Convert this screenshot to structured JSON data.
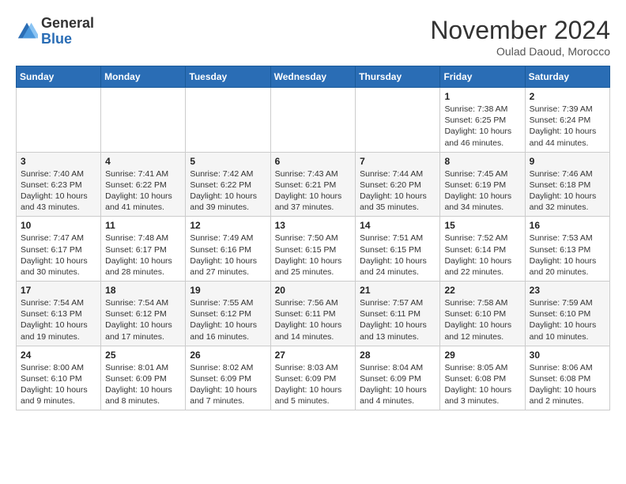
{
  "logo": {
    "general": "General",
    "blue": "Blue"
  },
  "title": "November 2024",
  "subtitle": "Oulad Daoud, Morocco",
  "days_header": [
    "Sunday",
    "Monday",
    "Tuesday",
    "Wednesday",
    "Thursday",
    "Friday",
    "Saturday"
  ],
  "weeks": [
    [
      {
        "day": "",
        "info": ""
      },
      {
        "day": "",
        "info": ""
      },
      {
        "day": "",
        "info": ""
      },
      {
        "day": "",
        "info": ""
      },
      {
        "day": "",
        "info": ""
      },
      {
        "day": "1",
        "info": "Sunrise: 7:38 AM\nSunset: 6:25 PM\nDaylight: 10 hours and 46 minutes."
      },
      {
        "day": "2",
        "info": "Sunrise: 7:39 AM\nSunset: 6:24 PM\nDaylight: 10 hours and 44 minutes."
      }
    ],
    [
      {
        "day": "3",
        "info": "Sunrise: 7:40 AM\nSunset: 6:23 PM\nDaylight: 10 hours and 43 minutes."
      },
      {
        "day": "4",
        "info": "Sunrise: 7:41 AM\nSunset: 6:22 PM\nDaylight: 10 hours and 41 minutes."
      },
      {
        "day": "5",
        "info": "Sunrise: 7:42 AM\nSunset: 6:22 PM\nDaylight: 10 hours and 39 minutes."
      },
      {
        "day": "6",
        "info": "Sunrise: 7:43 AM\nSunset: 6:21 PM\nDaylight: 10 hours and 37 minutes."
      },
      {
        "day": "7",
        "info": "Sunrise: 7:44 AM\nSunset: 6:20 PM\nDaylight: 10 hours and 35 minutes."
      },
      {
        "day": "8",
        "info": "Sunrise: 7:45 AM\nSunset: 6:19 PM\nDaylight: 10 hours and 34 minutes."
      },
      {
        "day": "9",
        "info": "Sunrise: 7:46 AM\nSunset: 6:18 PM\nDaylight: 10 hours and 32 minutes."
      }
    ],
    [
      {
        "day": "10",
        "info": "Sunrise: 7:47 AM\nSunset: 6:17 PM\nDaylight: 10 hours and 30 minutes."
      },
      {
        "day": "11",
        "info": "Sunrise: 7:48 AM\nSunset: 6:17 PM\nDaylight: 10 hours and 28 minutes."
      },
      {
        "day": "12",
        "info": "Sunrise: 7:49 AM\nSunset: 6:16 PM\nDaylight: 10 hours and 27 minutes."
      },
      {
        "day": "13",
        "info": "Sunrise: 7:50 AM\nSunset: 6:15 PM\nDaylight: 10 hours and 25 minutes."
      },
      {
        "day": "14",
        "info": "Sunrise: 7:51 AM\nSunset: 6:15 PM\nDaylight: 10 hours and 24 minutes."
      },
      {
        "day": "15",
        "info": "Sunrise: 7:52 AM\nSunset: 6:14 PM\nDaylight: 10 hours and 22 minutes."
      },
      {
        "day": "16",
        "info": "Sunrise: 7:53 AM\nSunset: 6:13 PM\nDaylight: 10 hours and 20 minutes."
      }
    ],
    [
      {
        "day": "17",
        "info": "Sunrise: 7:54 AM\nSunset: 6:13 PM\nDaylight: 10 hours and 19 minutes."
      },
      {
        "day": "18",
        "info": "Sunrise: 7:54 AM\nSunset: 6:12 PM\nDaylight: 10 hours and 17 minutes."
      },
      {
        "day": "19",
        "info": "Sunrise: 7:55 AM\nSunset: 6:12 PM\nDaylight: 10 hours and 16 minutes."
      },
      {
        "day": "20",
        "info": "Sunrise: 7:56 AM\nSunset: 6:11 PM\nDaylight: 10 hours and 14 minutes."
      },
      {
        "day": "21",
        "info": "Sunrise: 7:57 AM\nSunset: 6:11 PM\nDaylight: 10 hours and 13 minutes."
      },
      {
        "day": "22",
        "info": "Sunrise: 7:58 AM\nSunset: 6:10 PM\nDaylight: 10 hours and 12 minutes."
      },
      {
        "day": "23",
        "info": "Sunrise: 7:59 AM\nSunset: 6:10 PM\nDaylight: 10 hours and 10 minutes."
      }
    ],
    [
      {
        "day": "24",
        "info": "Sunrise: 8:00 AM\nSunset: 6:10 PM\nDaylight: 10 hours and 9 minutes."
      },
      {
        "day": "25",
        "info": "Sunrise: 8:01 AM\nSunset: 6:09 PM\nDaylight: 10 hours and 8 minutes."
      },
      {
        "day": "26",
        "info": "Sunrise: 8:02 AM\nSunset: 6:09 PM\nDaylight: 10 hours and 7 minutes."
      },
      {
        "day": "27",
        "info": "Sunrise: 8:03 AM\nSunset: 6:09 PM\nDaylight: 10 hours and 5 minutes."
      },
      {
        "day": "28",
        "info": "Sunrise: 8:04 AM\nSunset: 6:09 PM\nDaylight: 10 hours and 4 minutes."
      },
      {
        "day": "29",
        "info": "Sunrise: 8:05 AM\nSunset: 6:08 PM\nDaylight: 10 hours and 3 minutes."
      },
      {
        "day": "30",
        "info": "Sunrise: 8:06 AM\nSunset: 6:08 PM\nDaylight: 10 hours and 2 minutes."
      }
    ]
  ]
}
